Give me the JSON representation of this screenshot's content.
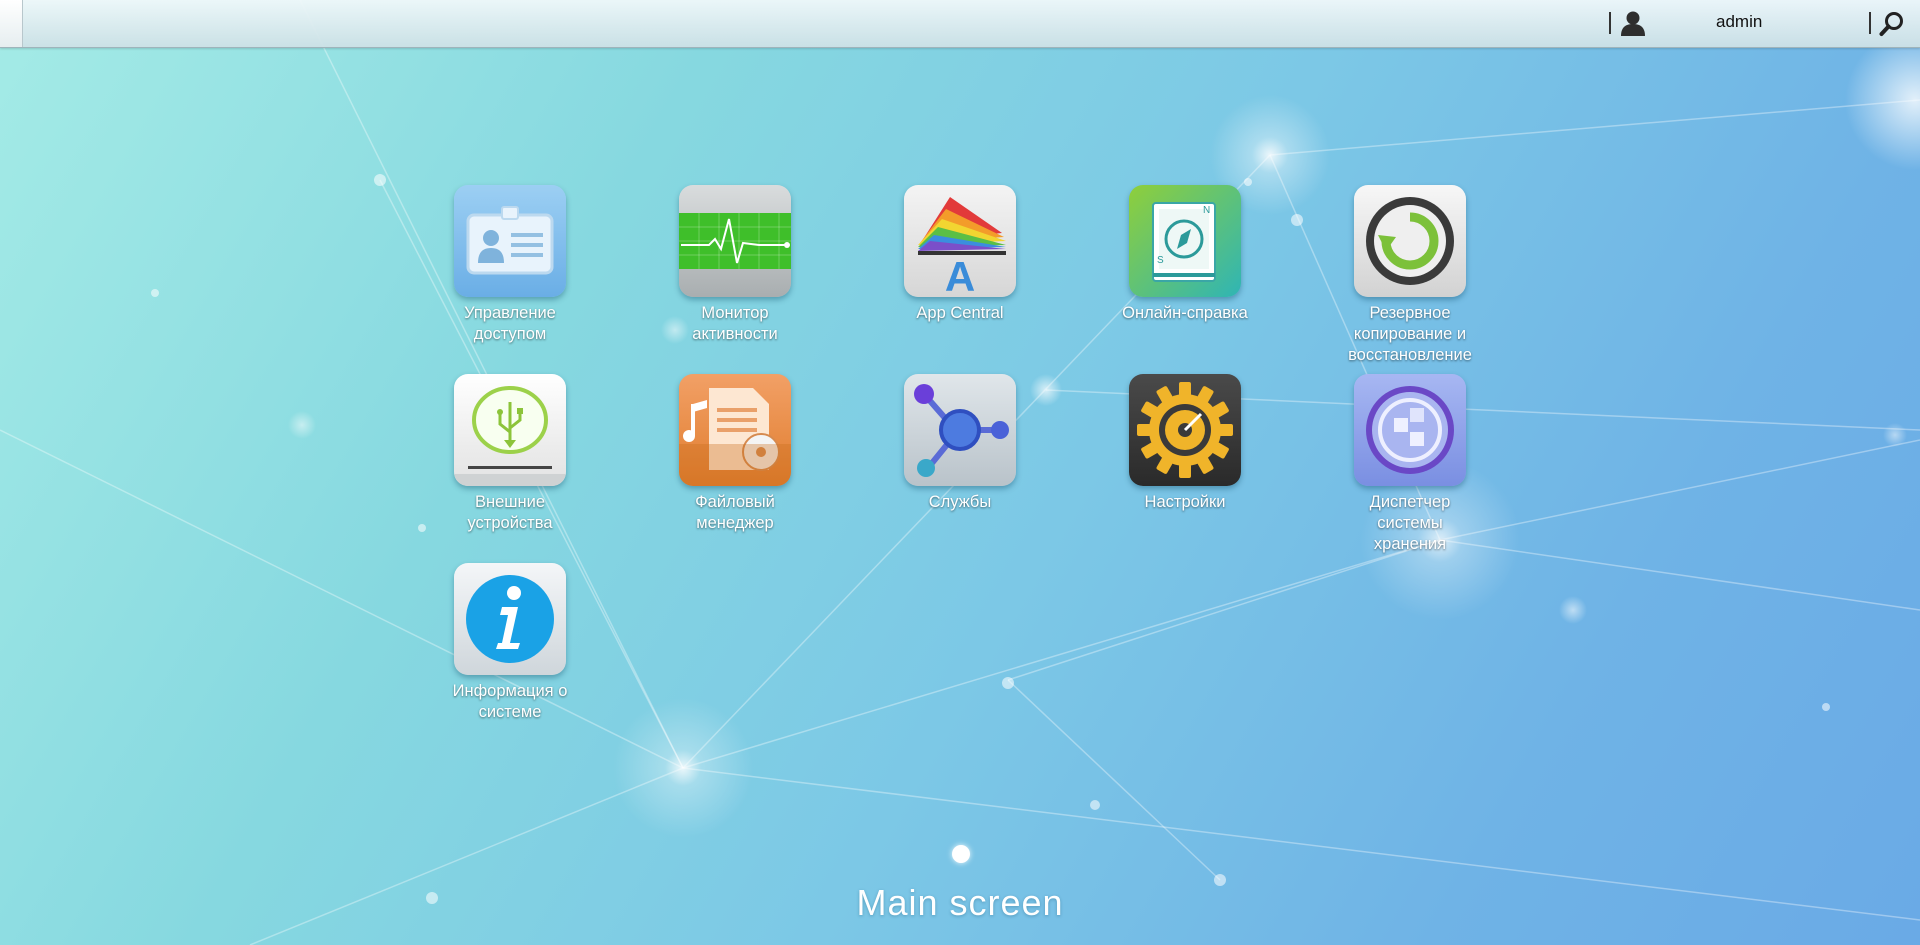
{
  "topbar": {
    "username": "admin"
  },
  "apps": [
    {
      "id": "access",
      "label": "Управление\nдоступом",
      "icon": "id-card-icon"
    },
    {
      "id": "monitor",
      "label": "Монитор\nактивности",
      "icon": "heartbeat-monitor-icon"
    },
    {
      "id": "appcentral",
      "label": "App Central",
      "icon": "app-central-icon"
    },
    {
      "id": "help",
      "label": "Онлайн-справка",
      "icon": "compass-book-icon"
    },
    {
      "id": "backup",
      "label": "Резервное\nкопирование и\nвосстановление",
      "icon": "backup-restore-icon"
    },
    {
      "id": "external",
      "label": "Внешние\nустройства",
      "icon": "usb-drive-icon"
    },
    {
      "id": "files",
      "label": "Файловый\nменеджер",
      "icon": "file-manager-icon"
    },
    {
      "id": "services",
      "label": "Службы",
      "icon": "services-nodes-icon"
    },
    {
      "id": "settings",
      "label": "Настройки",
      "icon": "gear-icon"
    },
    {
      "id": "storage",
      "label": "Диспетчер\nсистемы\nхранения",
      "icon": "storage-manager-icon"
    },
    {
      "id": "sysinfo",
      "label": "Информация о\nсистеме",
      "icon": "info-icon"
    }
  ],
  "footer": {
    "screen_name": "Main screen"
  },
  "colors": {
    "background_start": "#a4ebe6",
    "background_end": "#6aaae6",
    "label": "#ffffff"
  }
}
